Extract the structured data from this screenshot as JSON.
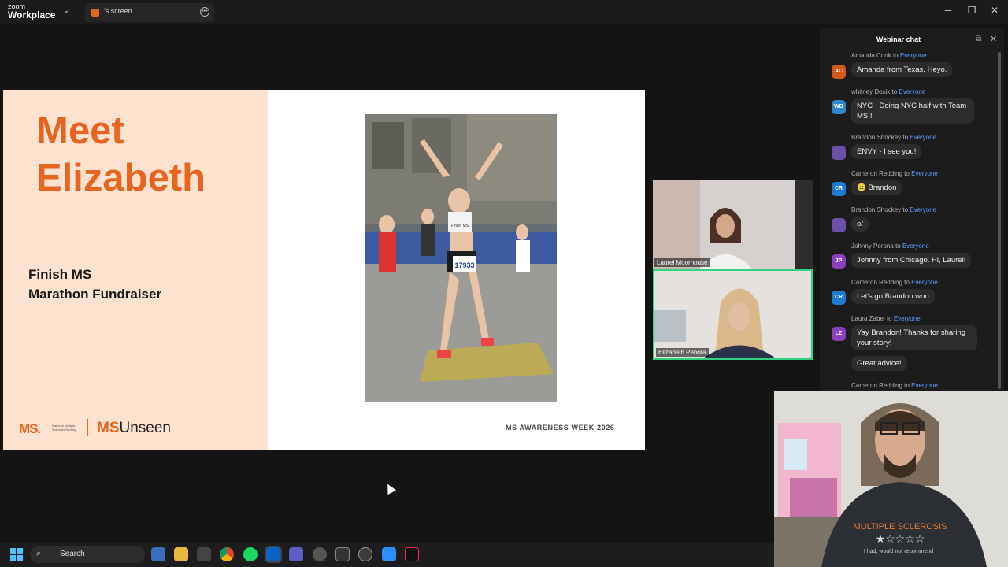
{
  "titlebar": {
    "logo_line1": "zoom",
    "logo_line2": "Workplace",
    "tab_label": "'s screen",
    "minimize": "─",
    "restore": "❐",
    "close": "✕"
  },
  "slide": {
    "title_line1": "Meet",
    "title_line2": "Elizabeth",
    "subtitle_line1": "Finish MS",
    "subtitle_line2": "Marathon Fundraiser",
    "logo_ms": "MS.",
    "logo_society": "National Multiple Sclerosis Society",
    "unseen_prefix": "MS",
    "unseen_suffix": "Unseen",
    "footer": "MS AWARENESS WEEK 2026",
    "bib_number": "17933",
    "shirt_text": "Finish MS"
  },
  "participants": [
    {
      "name": "Laurel Moorhouse"
    },
    {
      "name": "Elizabeth Peñota"
    }
  ],
  "chat": {
    "title": "Webinar chat",
    "to_word": "to",
    "everyone": "Everyone",
    "messages": [
      {
        "sender": "Amanda Cook",
        "initials": "AC",
        "color": "#d4581a",
        "text": "Amanda from Texas. Heyo."
      },
      {
        "sender": "whitney Dosik",
        "initials": "WD",
        "color": "#2f86c9",
        "text": "NYC - Doing NYC half with Team MS!!"
      },
      {
        "sender": "Brandon Shockey",
        "initials": "",
        "color": "#6b4fa8",
        "text": "ENVY - I see you!"
      },
      {
        "sender": "Cameron Redding",
        "initials": "CR",
        "color": "#1f7bd1",
        "text": "😐 Brandon"
      },
      {
        "sender": "Brandon Shockey",
        "initials": "",
        "color": "#6b4fa8",
        "text": "o/"
      },
      {
        "sender": "Johnny Perona",
        "initials": "JP",
        "color": "#8a3fbf",
        "text": "Johnny from Chicago. Hi, Laurel!"
      },
      {
        "sender": "Cameron Redding",
        "initials": "CR",
        "color": "#1f7bd1",
        "text": "Let's go Brandon woo"
      },
      {
        "sender": "Laura Zabel",
        "initials": "LZ",
        "color": "#8a3fbf",
        "text": "Yay Brandon! Thanks for sharing your story!",
        "extra": "Great advice!"
      },
      {
        "sender": "Cameron Redding",
        "initials": "",
        "color": "#1f7bd1",
        "text": ""
      }
    ]
  },
  "webcam": {
    "shirt_text": "MULTIPLE SCLEROSIS",
    "shirt_sub": "I had, would not recommend"
  },
  "taskbar": {
    "search_label": "Search",
    "icons": [
      "widgets-icon",
      "file-explorer-icon",
      "calculator-icon",
      "chrome-icon",
      "spotify-icon",
      "outlook-icon",
      "teams-icon",
      "app-icon",
      "terminal-icon",
      "media-player-icon",
      "zoom-icon",
      "tiktok-icon"
    ]
  },
  "colors": {
    "accent_orange": "#e8651f",
    "slide_peach": "#fde2cf",
    "active_speaker": "#35d07f",
    "everyone_link": "#5aa0ff"
  }
}
